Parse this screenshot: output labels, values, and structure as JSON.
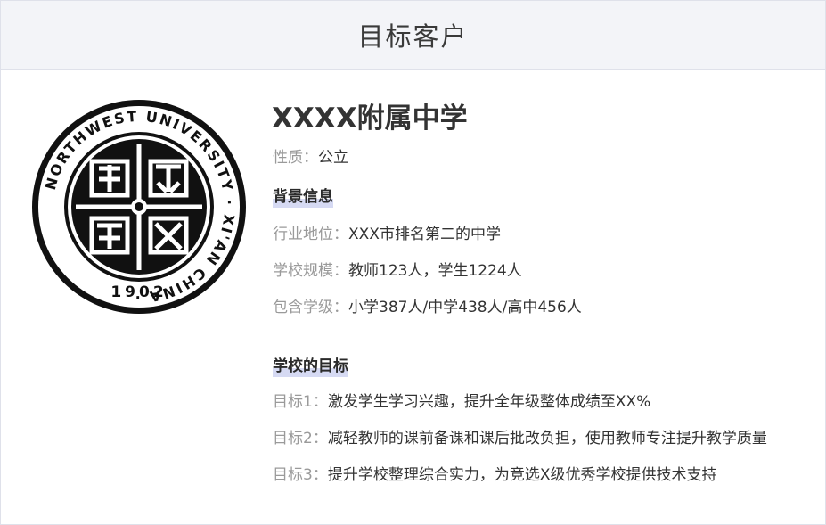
{
  "header": {
    "title": "目标客户"
  },
  "logo": {
    "ring_text": "NORTHWEST UNIVERSITY · XI'AN CHINA ·",
    "year": "1902"
  },
  "school": {
    "name": "XXXX附属中学",
    "nature_label": "性质：",
    "nature_value": "公立"
  },
  "background": {
    "title": "背景信息",
    "items": [
      {
        "label": "行业地位：",
        "value": "XXX市排名第二的中学"
      },
      {
        "label": "学校规模：",
        "value": "教师123人，学生1224人"
      },
      {
        "label": "包含学级：",
        "value": "小学387人/中学438人/高中456人"
      }
    ]
  },
  "goals": {
    "title": "学校的目标",
    "items": [
      {
        "label": "目标1：",
        "value": "激发学生学习兴趣，提升全年级整体成绩至XX%"
      },
      {
        "label": "目标2：",
        "value": "减轻教师的课前备课和课后批改负担，使用教师专注提升教学质量"
      },
      {
        "label": "目标3：",
        "value": "提升学校整理综合实力，为竞选X级优秀学校提供技术支持"
      }
    ]
  }
}
